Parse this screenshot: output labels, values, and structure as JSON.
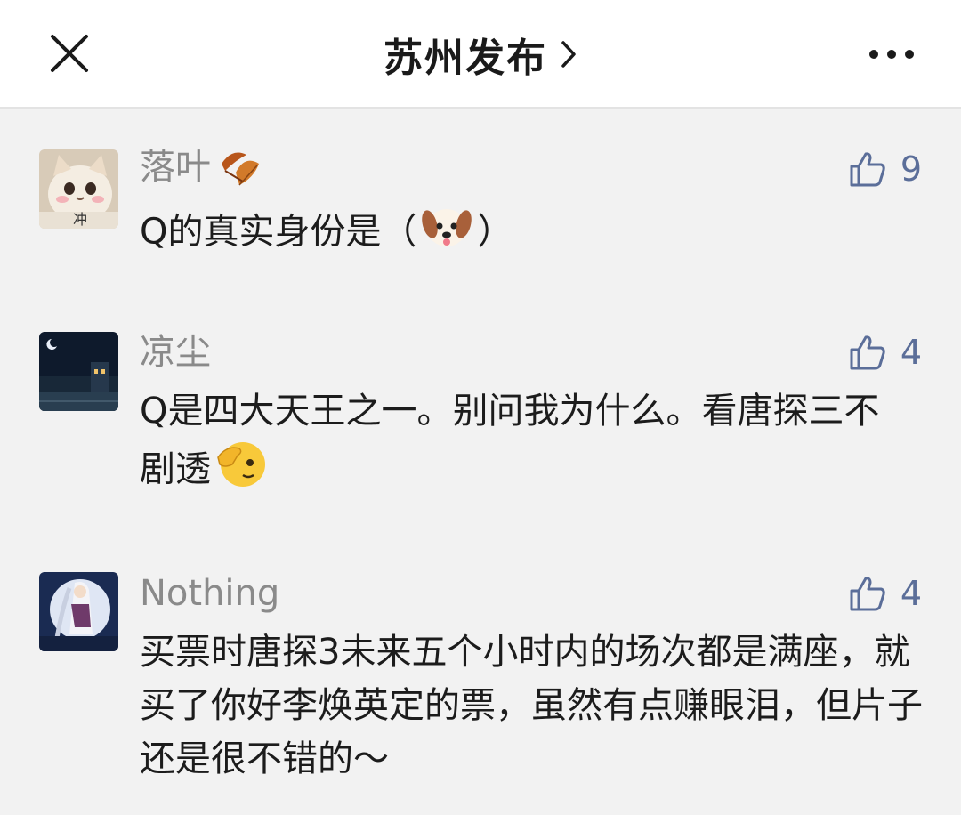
{
  "header": {
    "title": "苏州发布",
    "title_chevron": "›",
    "close_icon": "close-icon",
    "more_icon": "more-dots-icon"
  },
  "colors": {
    "background": "#f2f2f2",
    "header_bg": "#ffffff",
    "like_color": "#5b6e99",
    "nickname_color": "#8a8a8a"
  },
  "comments": [
    {
      "nickname": "落叶",
      "nickname_emoji": "fallen-leaf-icon",
      "avatar": "cat-avatar",
      "avatar_text": "冲",
      "likes": "9",
      "content_before": "Q的真实身份是（",
      "content_emoji": "dog-face-emoji",
      "content_after": "）"
    },
    {
      "nickname": "凉尘",
      "avatar": "night-scene-avatar",
      "likes": "4",
      "content_before": "Q是四大天王之一。别问我为什么。看唐探三不剧透",
      "content_emoji": "face-peeking-emoji",
      "content_after": ""
    },
    {
      "nickname": "Nothing",
      "avatar": "anime-character-avatar",
      "likes": "4",
      "content": "买票时唐探3未来五个小时内的场次都是满座，就买了你好李焕英定的票，虽然有点赚眼泪，但片子还是很不错的～"
    }
  ]
}
